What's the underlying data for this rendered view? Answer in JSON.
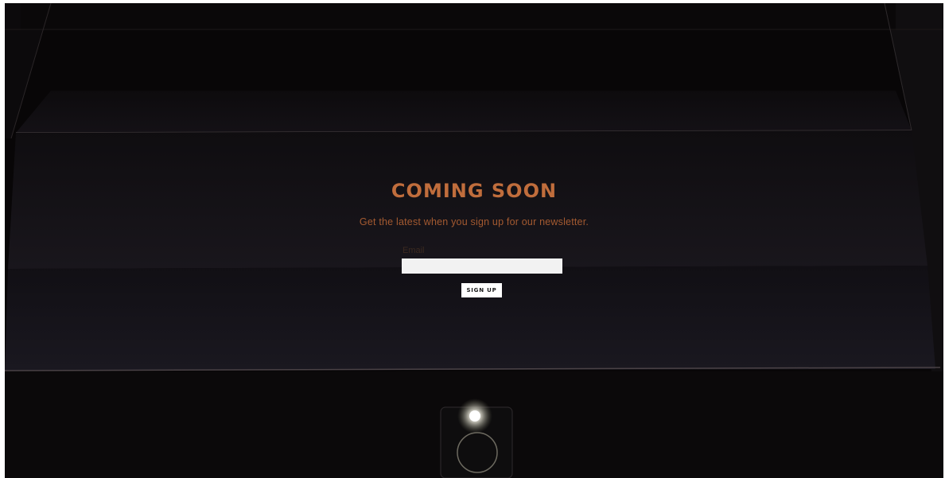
{
  "hero": {
    "title": "COMING SOON",
    "subtitle": "Get the latest when you sign up for our newsletter."
  },
  "form": {
    "email_label": "Email",
    "email_value": "",
    "signup_label": "SIGN UP"
  },
  "colors": {
    "accent": "#c06d3c",
    "subtitle": "#a45a30",
    "background": "#070506"
  }
}
